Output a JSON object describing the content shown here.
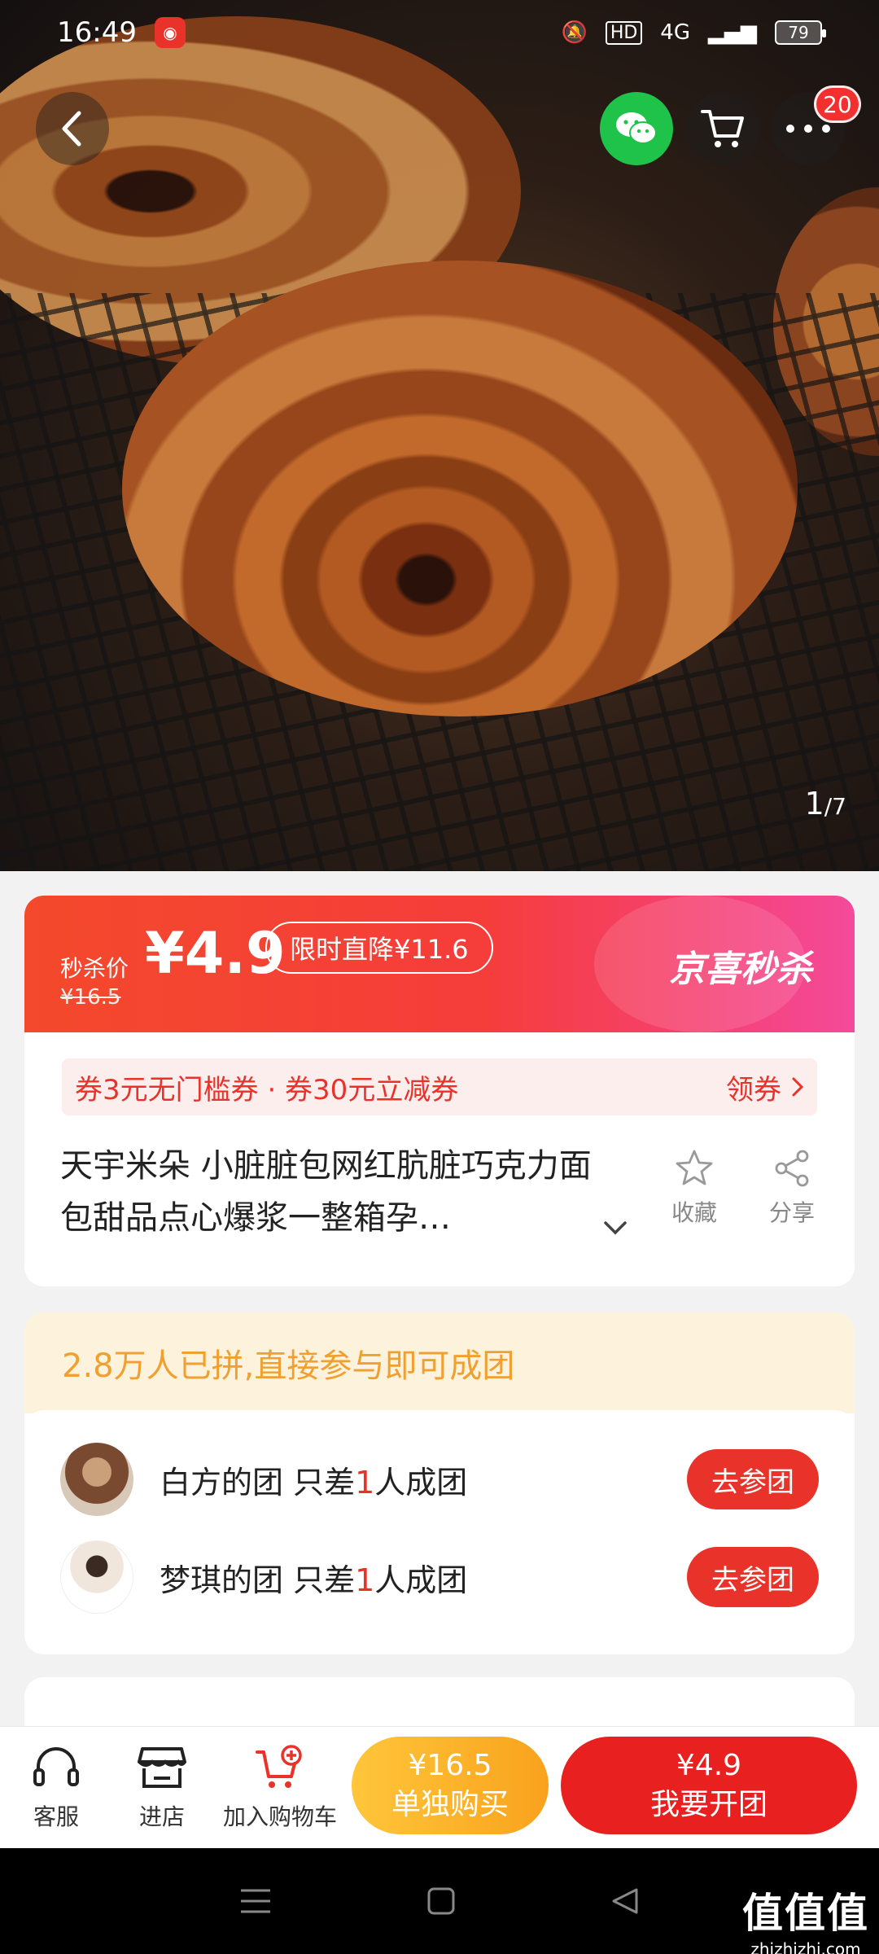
{
  "status": {
    "time": "16:49",
    "network": "4G",
    "hd": "HD",
    "battery": "79"
  },
  "gallery": {
    "current": "1",
    "total": "/7"
  },
  "cart_badge": "20",
  "flash": {
    "label": "秒杀价",
    "price": "¥4.9",
    "old_price": "¥16.5",
    "tag": "限时直降¥11.6",
    "brand": "京喜秒杀"
  },
  "coupon": {
    "text": "券3元无门槛券 · 券30元立减券",
    "action": "领券"
  },
  "product": {
    "title": "天宇米朵 小脏脏包网红肮脏巧克力面包甜品点心爆浆一整箱孕…",
    "favorite_label": "收藏",
    "share_label": "分享"
  },
  "group": {
    "header": "2.8万人已拼,直接参与即可成团",
    "rows": [
      {
        "owner": "白方的团 只差",
        "count": "1",
        "suffix": "人成团",
        "button": "去参团"
      },
      {
        "owner": "梦琪的团 只差",
        "count": "1",
        "suffix": "人成团",
        "button": "去参团"
      }
    ]
  },
  "bottom": {
    "service": "客服",
    "store": "进店",
    "add_cart": "加入购物车",
    "solo_price": "¥16.5",
    "solo_label": "单独购买",
    "group_price": "¥4.9",
    "group_label": "我要开团"
  },
  "watermark": {
    "big": "值值值",
    "small": "zhizhizhi.com"
  },
  "colors": {
    "accent_red": "#e8322a",
    "wechat_green": "#1fc34a",
    "solo_yellow": "#f9a21d",
    "group_orange": "#f0a030"
  },
  "icons": [
    "back-icon",
    "wechat-icon",
    "cart-icon",
    "more-icon",
    "star-icon",
    "share-icon",
    "headset-icon",
    "store-icon",
    "add-cart-icon"
  ]
}
